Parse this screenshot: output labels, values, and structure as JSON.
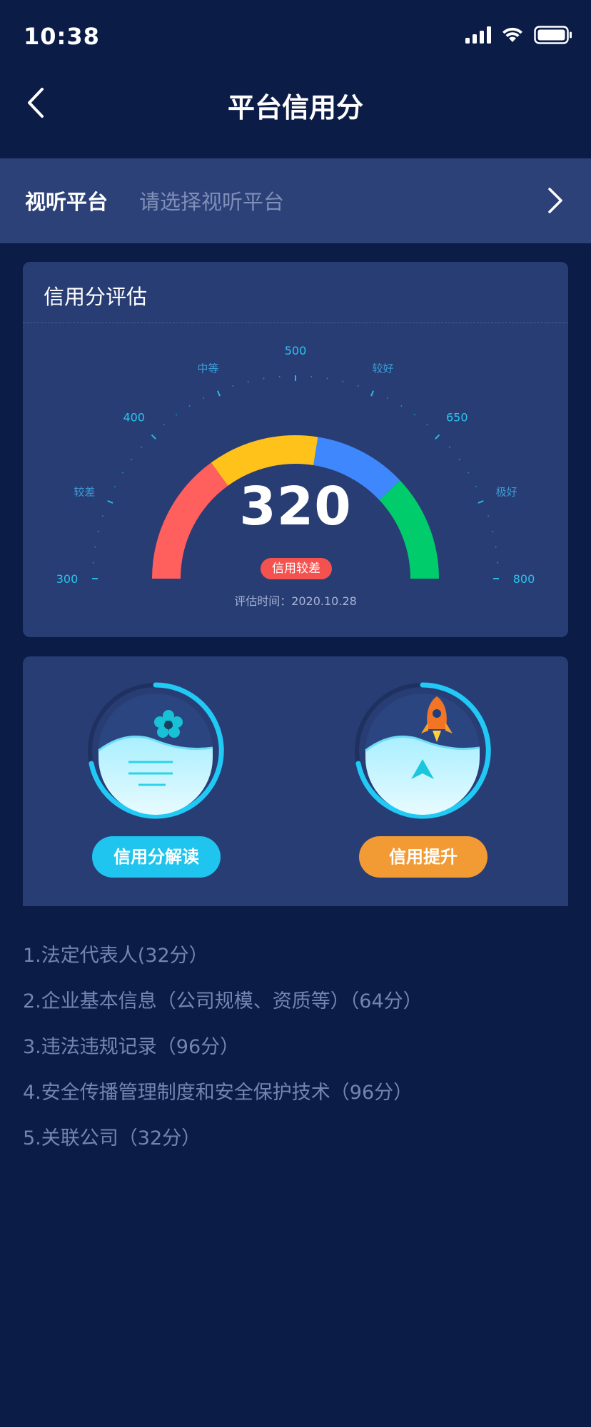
{
  "status_bar": {
    "time": "10:38"
  },
  "nav": {
    "title": "平台信用分"
  },
  "platform": {
    "label": "视听平台",
    "placeholder": "请选择视听平台"
  },
  "evaluation": {
    "title": "信用分评估",
    "score": "320",
    "badge": "信用较差",
    "eval_time": "评估时间：2020.10.28",
    "scale_labels": [
      "300",
      "较差",
      "400",
      "中等",
      "500",
      "较好",
      "650",
      "极好",
      "800"
    ],
    "segments": [
      {
        "from": 300,
        "to": 450,
        "color": "#ff5f5d"
      },
      {
        "from": 450,
        "to": 575,
        "color": "#ffc21a"
      },
      {
        "from": 575,
        "to": 680,
        "color": "#3f87fd"
      },
      {
        "from": 680,
        "to": 800,
        "color": "#00cc6c"
      }
    ],
    "scale_min": 300,
    "scale_max": 800,
    "label_color": "#2bc4ef",
    "label_text_color": "#3d9cd6"
  },
  "actions": {
    "interpret": {
      "label": "信用分解读",
      "color": "#1fc4ef",
      "icon": "flower-water-icon"
    },
    "improve": {
      "label": "信用提升",
      "color": "#f29b35",
      "icon": "rocket-icon"
    }
  },
  "criteria": [
    "1.法定代表人(32分）",
    "2.企业基本信息（公司规模、资质等）（64分）",
    "3.违法违规记录（96分）",
    "4.安全传播管理制度和安全保护技术（96分）",
    "5.关联公司（32分）"
  ]
}
